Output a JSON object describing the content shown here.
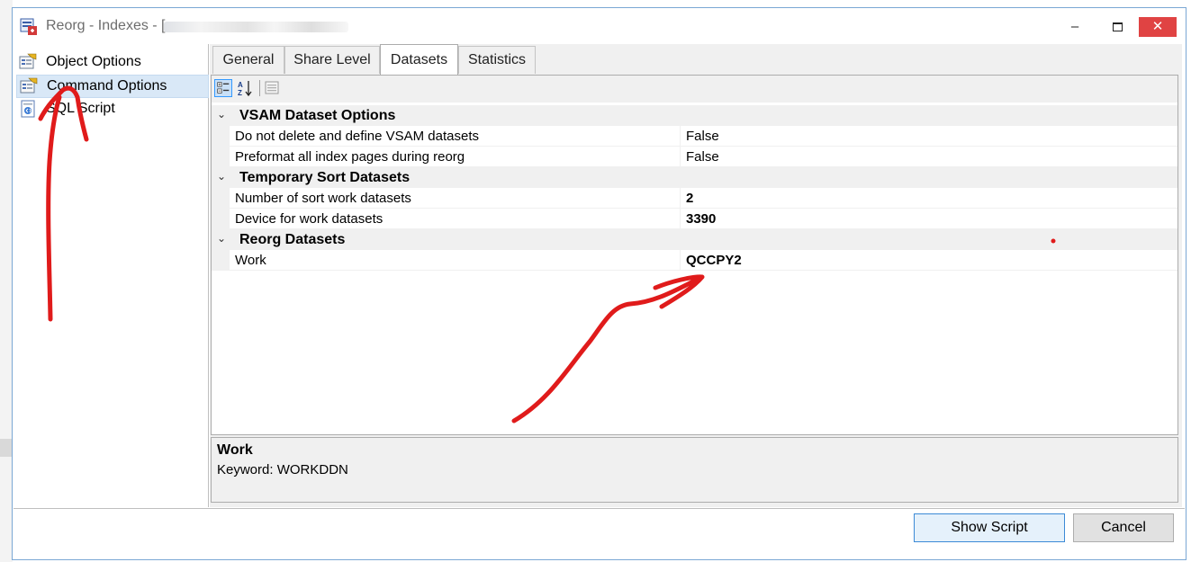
{
  "window": {
    "title": "Reorg - Indexes - [",
    "minimize_icon": "minimize-icon",
    "maximize_icon": "maximize-icon",
    "close_icon": "close-icon"
  },
  "nav": {
    "items": [
      {
        "label": "Object Options",
        "icon": "object-options-icon",
        "selected": false
      },
      {
        "label": "Command Options",
        "icon": "command-options-icon",
        "selected": true
      },
      {
        "label": "SQL Script",
        "icon": "sql-script-icon",
        "selected": false
      }
    ]
  },
  "tabs": [
    {
      "label": "General",
      "active": false
    },
    {
      "label": "Share Level",
      "active": false
    },
    {
      "label": "Datasets",
      "active": true
    },
    {
      "label": "Statistics",
      "active": false
    }
  ],
  "toolbar": {
    "categorized_icon": "categorized-icon",
    "alphabetical_icon": "alphabetical-sort-icon",
    "property_pages_icon": "property-pages-icon"
  },
  "grid": {
    "categories": [
      {
        "title": "VSAM Dataset Options",
        "rows": [
          {
            "name": "Do not delete and define VSAM datasets",
            "value": "False",
            "bold": false
          },
          {
            "name": "Preformat all index pages during reorg",
            "value": "False",
            "bold": false
          }
        ]
      },
      {
        "title": "Temporary Sort Datasets",
        "rows": [
          {
            "name": "Number of sort work datasets",
            "value": "2",
            "bold": true
          },
          {
            "name": "Device for work datasets",
            "value": "3390",
            "bold": true
          }
        ]
      },
      {
        "title": "Reorg Datasets",
        "rows": [
          {
            "name": "Work",
            "value": "QCCPY2",
            "bold": true
          }
        ]
      }
    ]
  },
  "description": {
    "title": "Work",
    "text": "Keyword: WORKDDN"
  },
  "footer": {
    "show_script_label": "Show Script",
    "cancel_label": "Cancel"
  },
  "annotation_color": "#e01b1b"
}
